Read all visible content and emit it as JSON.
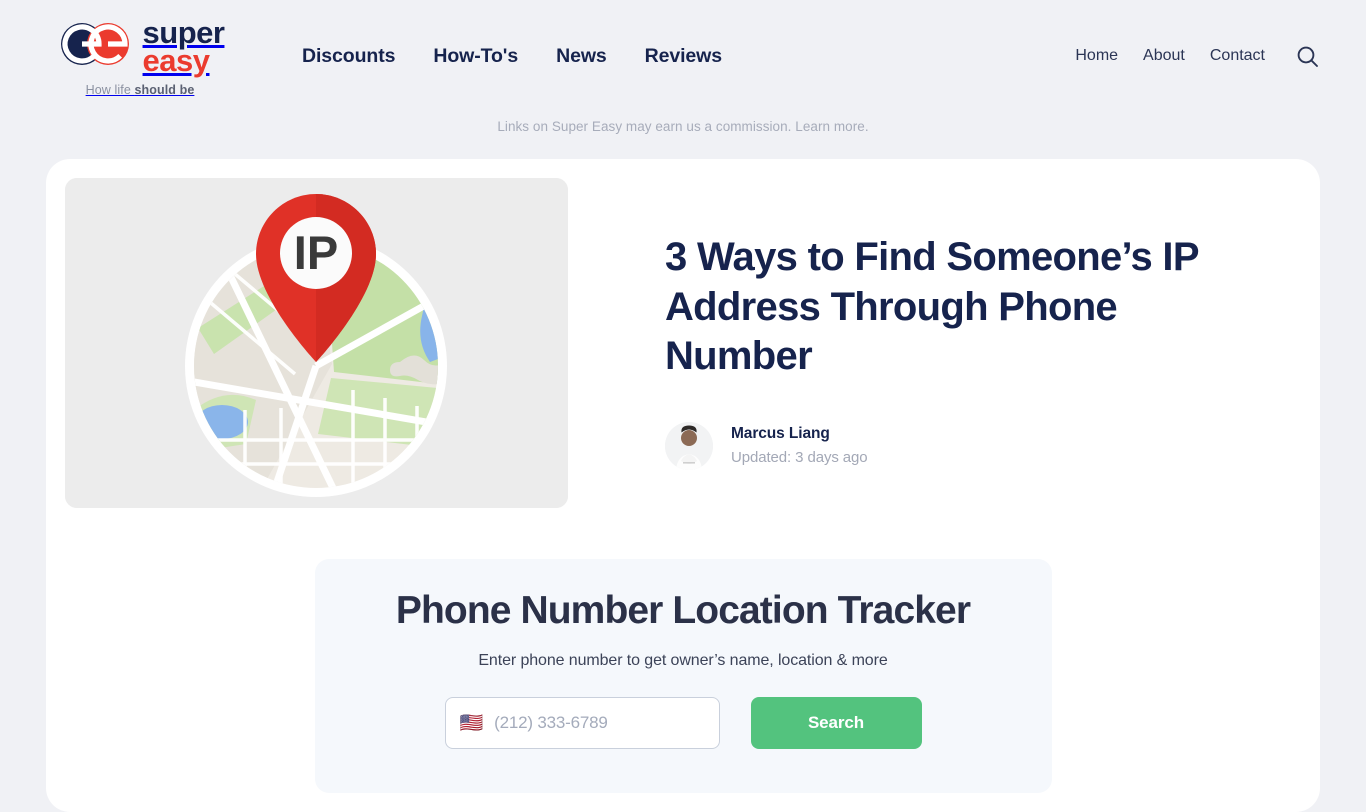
{
  "brand": {
    "name_line1": "super",
    "name_line2": "easy",
    "tagline_prefix": "How life ",
    "tagline_strong": "should be",
    "logo_icon": "superEasy-double-e-logo",
    "navy": "#16234d",
    "red": "#eb3b2e"
  },
  "nav": {
    "primary": [
      {
        "label": "Discounts"
      },
      {
        "label": "How-To's"
      },
      {
        "label": "News"
      },
      {
        "label": "Reviews"
      }
    ],
    "utility": [
      {
        "label": "Home"
      },
      {
        "label": "About"
      },
      {
        "label": "Contact"
      }
    ],
    "search_icon": "search-icon"
  },
  "disclaimer": {
    "text": "Links on Super Easy may earn us a commission.",
    "link_label": "Learn more."
  },
  "article": {
    "title": "3 Ways to Find Someone’s IP Address Through Phone Number",
    "hero_alt": "map-pin-ip-illustration",
    "hero_badge": "IP",
    "author": "Marcus Liang",
    "updated": "Updated: 3 days ago"
  },
  "tracker": {
    "title": "Phone Number Location Tracker",
    "subtitle": "Enter phone number to get owner’s name, location & more",
    "country_flag": "🇺🇸",
    "phone_placeholder": "(212) 333-6789",
    "phone_value": "",
    "search_label": "Search",
    "button_color": "#53c37e"
  }
}
